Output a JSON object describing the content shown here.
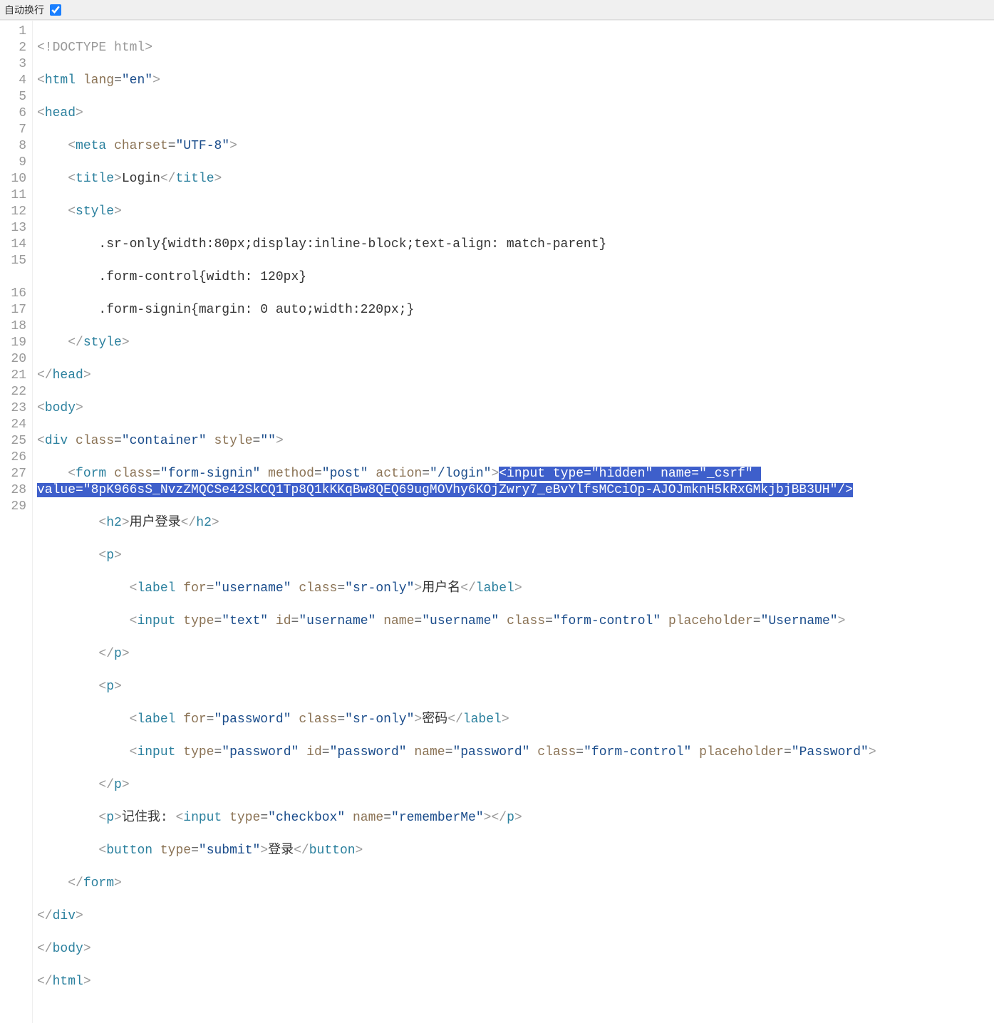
{
  "toolbar": {
    "wrap_label": "自动换行"
  },
  "line_numbers": [
    "1",
    "2",
    "3",
    "4",
    "5",
    "6",
    "7",
    "8",
    "9",
    "10",
    "11",
    "12",
    "13",
    "14",
    "15",
    "16",
    "17",
    "18",
    "19",
    "20",
    "21",
    "22",
    "23",
    "24",
    "25",
    "26",
    "27",
    "28",
    "29"
  ],
  "code": {
    "l1_doctype": "<!DOCTYPE html>",
    "l2": {
      "tag": "html",
      "attr": "lang",
      "val": "\"en\""
    },
    "l3": {
      "tag": "head"
    },
    "l4": {
      "tag": "meta",
      "attr": "charset",
      "val": "\"UTF-8\""
    },
    "l5": {
      "open": "title",
      "text": "Login",
      "close": "title"
    },
    "l6": {
      "tag": "style"
    },
    "l7": ".sr-only{width:80px;display:inline-block;text-align: match-parent}",
    "l8": ".form-control{width: 120px}",
    "l9": ".form-signin{margin: 0 auto;width:220px;}",
    "l10": {
      "close": "style"
    },
    "l11": {
      "close": "head"
    },
    "l12": {
      "tag": "body"
    },
    "l13": {
      "tag": "div",
      "a1": "class",
      "v1": "\"container\"",
      "a2": "style",
      "v2": "\"\""
    },
    "l14": {
      "form": {
        "tag": "form",
        "a1": "class",
        "v1": "\"form-signin\"",
        "a2": "method",
        "v2": "\"post\"",
        "a3": "action",
        "v3": "\"/login\""
      },
      "hidden_open": "<input type=\"hidden\" name=\"_csrf\" ",
      "hidden_value": "value=\"8pK966sS_NvzZMQCSe42SkCQ1Tp8Q1kKKqBw8QEQ69ugMOVhy6KOjZwry7_eBvYlfsMCciOp-AJOJmknH5kRxGMkjbjBB3UH\"/>"
    },
    "l15": {
      "open": "h2",
      "text": "用户登录",
      "close": "h2"
    },
    "l16": {
      "tag": "p"
    },
    "l17": {
      "tag": "label",
      "a1": "for",
      "v1": "\"username\"",
      "a2": "class",
      "v2": "\"sr-only\"",
      "text": "用户名"
    },
    "l18": {
      "tag": "input",
      "a1": "type",
      "v1": "\"text\"",
      "a2": "id",
      "v2": "\"username\"",
      "a3": "name",
      "v3": "\"username\"",
      "a4": "class",
      "v4": "\"form-control\"",
      "a5": "placeholder",
      "v5": "\"Username\""
    },
    "l19": {
      "close": "p"
    },
    "l20": {
      "tag": "p"
    },
    "l21": {
      "tag": "label",
      "a1": "for",
      "v1": "\"password\"",
      "a2": "class",
      "v2": "\"sr-only\"",
      "text": "密码"
    },
    "l22": {
      "tag": "input",
      "a1": "type",
      "v1": "\"password\"",
      "a2": "id",
      "v2": "\"password\"",
      "a3": "name",
      "v3": "\"password\"",
      "a4": "class",
      "v4": "\"form-control\"",
      "a5": "placeholder",
      "v5": "\"Password\""
    },
    "l23": {
      "close": "p"
    },
    "l24": {
      "tag_open": "p",
      "text1": "记住我: ",
      "inner_tag": "input",
      "ia1": "type",
      "iv1": "\"checkbox\"",
      "ia2": "name",
      "iv2": "\"rememberMe\"",
      "tag_close": "p"
    },
    "l25": {
      "tag": "button",
      "a1": "type",
      "v1": "\"submit\"",
      "text": "登录"
    },
    "l26": {
      "close": "form"
    },
    "l27": {
      "close": "div"
    },
    "l28": {
      "close": "body"
    },
    "l29": {
      "close": "html"
    }
  }
}
